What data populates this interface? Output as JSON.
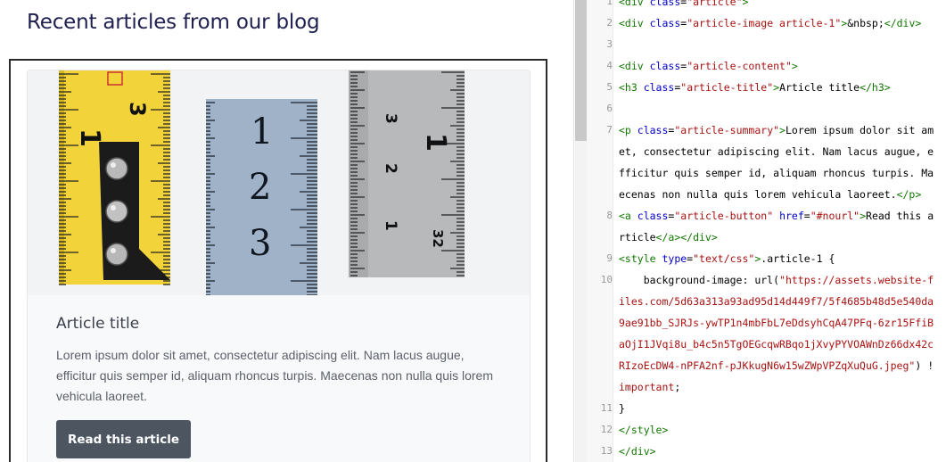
{
  "preview": {
    "heading": "Recent articles from our blog",
    "article": {
      "title": "Article title",
      "summary": "Lorem ipsum dolor sit amet, consectetur adipiscing elit. Nam lacus augue, efficitur quis semper id, aliquam rhoncus turpis. Maecenas non nulla quis lorem vehicula laoreet.",
      "button_label": "Read this article",
      "image_subject": "measuring-tapes-photo"
    }
  },
  "editor": {
    "lines": [
      {
        "n": "1",
        "parts": [
          {
            "t": "tag",
            "v": "<div "
          },
          {
            "t": "attr",
            "v": "class"
          },
          {
            "t": "txt",
            "v": "="
          },
          {
            "t": "str",
            "v": "\"article\""
          },
          {
            "t": "tag",
            "v": ">"
          }
        ]
      },
      {
        "n": "2",
        "parts": [
          {
            "t": "tag",
            "v": "<div "
          },
          {
            "t": "attr",
            "v": "class"
          },
          {
            "t": "txt",
            "v": "="
          },
          {
            "t": "str",
            "v": "\"article-image article-1\""
          },
          {
            "t": "tag",
            "v": ">"
          },
          {
            "t": "txt",
            "v": "&nbsp;"
          },
          {
            "t": "tag",
            "v": "</div>"
          }
        ]
      },
      {
        "n": "3",
        "parts": []
      },
      {
        "n": "4",
        "parts": [
          {
            "t": "tag",
            "v": "<div "
          },
          {
            "t": "attr",
            "v": "class"
          },
          {
            "t": "txt",
            "v": "="
          },
          {
            "t": "str",
            "v": "\"article-content\""
          },
          {
            "t": "tag",
            "v": ">"
          }
        ]
      },
      {
        "n": "5",
        "parts": [
          {
            "t": "tag",
            "v": "<h3 "
          },
          {
            "t": "attr",
            "v": "class"
          },
          {
            "t": "txt",
            "v": "="
          },
          {
            "t": "str",
            "v": "\"article-title\""
          },
          {
            "t": "tag",
            "v": ">"
          },
          {
            "t": "txt",
            "v": "Article title"
          },
          {
            "t": "tag",
            "v": "</h3>"
          }
        ]
      },
      {
        "n": "6",
        "parts": []
      },
      {
        "n": "7",
        "parts": [
          {
            "t": "tag",
            "v": "<p "
          },
          {
            "t": "attr",
            "v": "class"
          },
          {
            "t": "txt",
            "v": "="
          },
          {
            "t": "str",
            "v": "\"article-summary\""
          },
          {
            "t": "tag",
            "v": ">"
          },
          {
            "t": "txt",
            "v": "Lorem ipsum dolor sit am"
          }
        ]
      },
      {
        "n": "",
        "parts": [
          {
            "t": "txt",
            "v": "et, consectetur adipiscing elit. Nam lacus augue, e"
          }
        ]
      },
      {
        "n": "",
        "parts": [
          {
            "t": "txt",
            "v": "fficitur quis semper id, aliquam rhoncus turpis. Ma"
          }
        ]
      },
      {
        "n": "",
        "parts": [
          {
            "t": "txt",
            "v": "ecenas non nulla quis lorem vehicula laoreet."
          },
          {
            "t": "tag",
            "v": "</p>"
          }
        ]
      },
      {
        "n": "8",
        "parts": [
          {
            "t": "tag",
            "v": "<a "
          },
          {
            "t": "attr",
            "v": "class"
          },
          {
            "t": "txt",
            "v": "="
          },
          {
            "t": "str",
            "v": "\"article-button\""
          },
          {
            "t": "txt",
            "v": " "
          },
          {
            "t": "attr",
            "v": "href"
          },
          {
            "t": "txt",
            "v": "="
          },
          {
            "t": "str",
            "v": "\"#nourl\""
          },
          {
            "t": "tag",
            "v": ">"
          },
          {
            "t": "txt",
            "v": "Read this a"
          }
        ]
      },
      {
        "n": "",
        "parts": [
          {
            "t": "txt",
            "v": "rticle"
          },
          {
            "t": "tag",
            "v": "</a></div>"
          }
        ]
      },
      {
        "n": "9",
        "parts": [
          {
            "t": "tag",
            "v": "<style "
          },
          {
            "t": "attr",
            "v": "type"
          },
          {
            "t": "txt",
            "v": "="
          },
          {
            "t": "str",
            "v": "\"text/css\""
          },
          {
            "t": "tag",
            "v": ">"
          },
          {
            "t": "css-sel",
            "v": ".article-1 {"
          }
        ]
      },
      {
        "n": "10",
        "parts": [
          {
            "t": "css-prop",
            "v": "    background-image: "
          },
          {
            "t": "txt",
            "v": "url("
          },
          {
            "t": "str",
            "v": "\"https://assets.website-f"
          }
        ]
      },
      {
        "n": "",
        "parts": [
          {
            "t": "str",
            "v": "iles.com/5d63a313a93ad95d14d449f7/5f4685b48d5e540da"
          }
        ]
      },
      {
        "n": "",
        "parts": [
          {
            "t": "str",
            "v": "9ae91bb_SJRJs-ywTP1n4mbFbL7eDdsyhCqA47PFq-6zr15FfiB"
          }
        ]
      },
      {
        "n": "",
        "parts": [
          {
            "t": "str",
            "v": "aOjI1JVqi8u_b4c5n5TgOEGcqwRBqo1jXvyPYVOAWnDz66dx42c"
          }
        ]
      },
      {
        "n": "",
        "parts": [
          {
            "t": "str",
            "v": "RIzoEcDW4-nPFA2nf-pJKkugN6w15wZWpVPZqXuQuG.jpeg\""
          },
          {
            "t": "txt",
            "v": ") !"
          }
        ]
      },
      {
        "n": "",
        "parts": [
          {
            "t": "str",
            "v": "important"
          },
          {
            "t": "txt",
            "v": ";"
          }
        ]
      },
      {
        "n": "11",
        "parts": [
          {
            "t": "txt",
            "v": "}"
          }
        ]
      },
      {
        "n": "12",
        "parts": [
          {
            "t": "tag",
            "v": "</style>"
          }
        ]
      },
      {
        "n": "13",
        "parts": [
          {
            "t": "tag",
            "v": "</div>"
          }
        ]
      }
    ]
  }
}
